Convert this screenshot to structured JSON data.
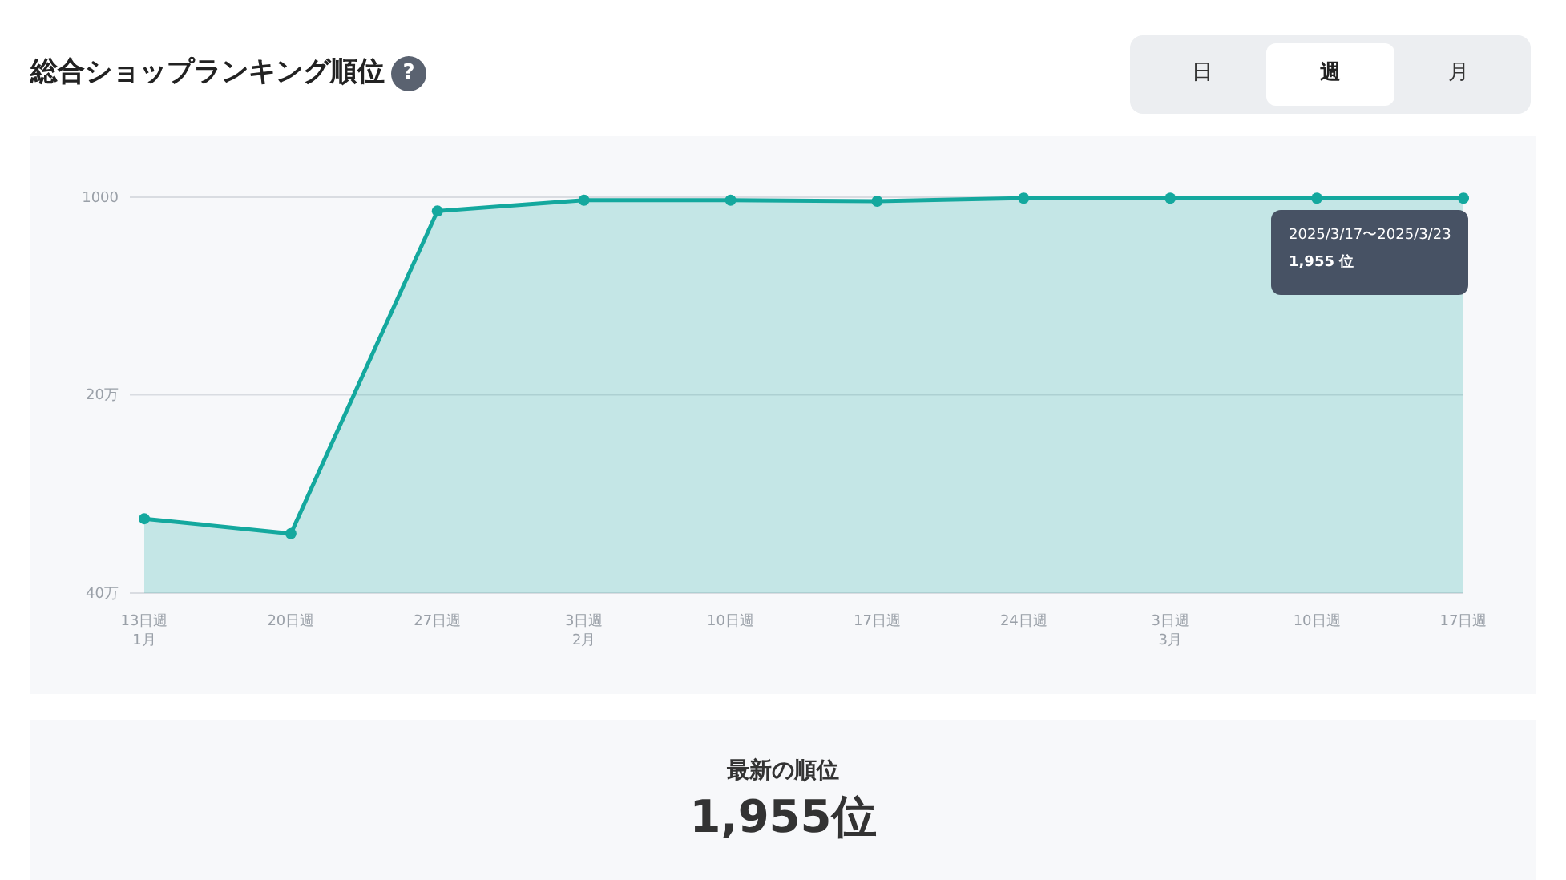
{
  "header": {
    "title": "総合ショップランキング順位",
    "help_icon": "?"
  },
  "period_tabs": [
    {
      "label": "日",
      "selected": false
    },
    {
      "label": "週",
      "selected": true
    },
    {
      "label": "月",
      "selected": false
    }
  ],
  "chart": {
    "chart_data": {
      "type": "line",
      "categories": [
        "13日週\n1月",
        "20日週",
        "27日週",
        "3日週\n2月",
        "10日週",
        "17日週",
        "24日週",
        "3日週\n3月",
        "10日週",
        "17日週"
      ],
      "series": [
        {
          "color": "#14a89e",
          "marker": "circle",
          "values": [
            32.5,
            34,
            1.5,
            0.4,
            0.4,
            0.5,
            0.2,
            0.2,
            0.2,
            0.2
          ]
        }
      ],
      "ylim": [
        40,
        0.1
      ],
      "yticks": [
        {
          "value": 20,
          "label": "20万"
        },
        {
          "value": 40,
          "label": "40万"
        }
      ]
    },
    "y_axis_top_label": "1000",
    "tooltip": {
      "period": "2025/3/17〜2025/3/23",
      "rank": "1,955 位"
    }
  },
  "latest": {
    "label": "最新の順位",
    "value": "1,955位"
  }
}
